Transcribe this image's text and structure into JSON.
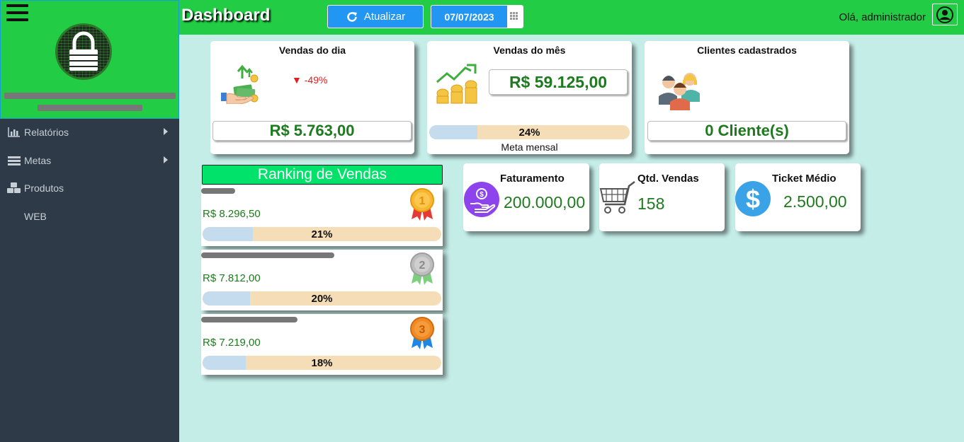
{
  "header": {
    "title": "Dashboard",
    "refresh_label": "Atualizar",
    "date": "07/07/2023",
    "greeting": "Olá, administrador"
  },
  "sidebar": {
    "items": [
      {
        "label": "Relatórios",
        "icon": "bar-chart-icon"
      },
      {
        "label": "Metas",
        "icon": "list-icon"
      },
      {
        "label": "Produtos",
        "icon": "cubes-icon"
      },
      {
        "label": "WEB",
        "icon": ""
      }
    ]
  },
  "cards": {
    "daily": {
      "title": "Vendas do dia",
      "change": "▼ -49%",
      "value": "R$ 5.763,00"
    },
    "monthly": {
      "title": "Vendas do mês",
      "value": "R$ 59.125,00",
      "progress_text": "24%",
      "progress": 0.24,
      "goal_label": "Meta mensal"
    },
    "clients": {
      "title": "Clientes cadastrados",
      "value": "0 Cliente(s)"
    }
  },
  "ranking": {
    "title": "Ranking de Vendas",
    "rows": [
      {
        "value": "R$ 8.296,50",
        "percent_text": "21%",
        "percent": 0.21
      },
      {
        "value": "R$ 7.812,00",
        "percent_text": "20%",
        "percent": 0.2
      },
      {
        "value": "R$ 7.219,00",
        "percent_text": "18%",
        "percent": 0.18
      }
    ]
  },
  "kpis": {
    "faturamento": {
      "title": "Faturamento",
      "value": "200.000,00"
    },
    "qtd_vendas": {
      "title": "Qtd. Vendas",
      "value": "158"
    },
    "ticket": {
      "title": "Ticket Médio",
      "value": "2.500,00"
    }
  },
  "colors": {
    "header_green": "#22cc44",
    "sidebar": "#2e3a47",
    "background": "#c5ede8",
    "value_green": "#1e7a1e",
    "accent_blue": "#2196f3",
    "negative_red": "#e02020"
  }
}
